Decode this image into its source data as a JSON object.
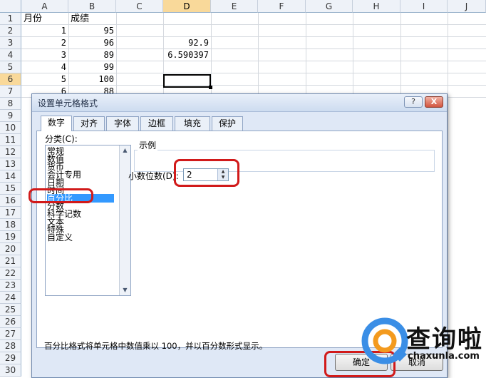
{
  "sheet": {
    "columns": [
      "A",
      "B",
      "C",
      "D",
      "E",
      "F",
      "G",
      "H",
      "I",
      "J"
    ],
    "selected_column": "D",
    "rows": [
      "1",
      "2",
      "3",
      "4",
      "5",
      "6",
      "7",
      "8",
      "9",
      "10",
      "11",
      "12",
      "13",
      "14",
      "15",
      "16",
      "17",
      "18",
      "19",
      "20",
      "21",
      "22",
      "23",
      "24",
      "25",
      "26",
      "27",
      "28",
      "29",
      "30"
    ],
    "selected_row": "6",
    "cells": {
      "A1": "月份",
      "B1": "成绩",
      "A2": "1",
      "B2": "95",
      "A3": "2",
      "B3": "96",
      "D3": "92.9",
      "A4": "3",
      "B4": "89",
      "D4": "6.590397",
      "A5": "4",
      "B5": "99",
      "A6": "5",
      "B6": "100",
      "A7": "6",
      "B7": "88"
    }
  },
  "dialog": {
    "title": "设置单元格格式",
    "help_button": "?",
    "close_button": "X",
    "tabs": [
      "数字",
      "对齐",
      "字体",
      "边框",
      "填充",
      "保护"
    ],
    "active_tab": "数字",
    "category_label": "分类(C):",
    "categories": [
      "常规",
      "数值",
      "货币",
      "会计专用",
      "日期",
      "时间",
      "百分比",
      "分数",
      "科学记数",
      "文本",
      "特殊",
      "自定义"
    ],
    "selected_category": "百分比",
    "sample_label": "示例",
    "decimal_label": "小数位数(D):",
    "decimal_value": "2",
    "description": "百分比格式将单元格中数值乘以 100，并以百分数形式显示。",
    "ok_label": "确定",
    "cancel_label": "取消"
  },
  "watermark": {
    "brand": "查询啦",
    "url": "chaxunla.com"
  },
  "colors": {
    "highlight": "#d11a1a",
    "selection": "#3399ff",
    "header_selected": "#f9d99a"
  }
}
